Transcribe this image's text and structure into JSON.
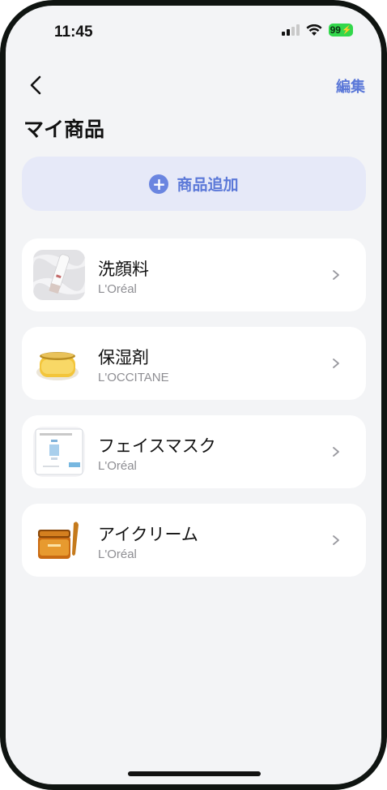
{
  "status_bar": {
    "time": "11:45",
    "battery": "99"
  },
  "nav": {
    "edit_label": "編集"
  },
  "page": {
    "title": "マイ商品"
  },
  "add_button": {
    "label": "商品追加",
    "icon": "plus-circle-icon"
  },
  "products": [
    {
      "name": "洗顔料",
      "brand": "L'Oréal",
      "thumbnail": "cleanser-tube"
    },
    {
      "name": "保湿剤",
      "brand": "L'OCCITANE",
      "thumbnail": "cream-jar-yellow"
    },
    {
      "name": "フェイスマスク",
      "brand": "L'Oréal",
      "thumbnail": "sheet-mask-pack"
    },
    {
      "name": "アイクリーム",
      "brand": "L'Oréal",
      "thumbnail": "gold-cream-jar"
    }
  ],
  "colors": {
    "accent": "#5b78d8",
    "add_button_bg": "#e6e9f8",
    "screen_bg": "#f3f4f6",
    "battery": "#32d74b"
  }
}
